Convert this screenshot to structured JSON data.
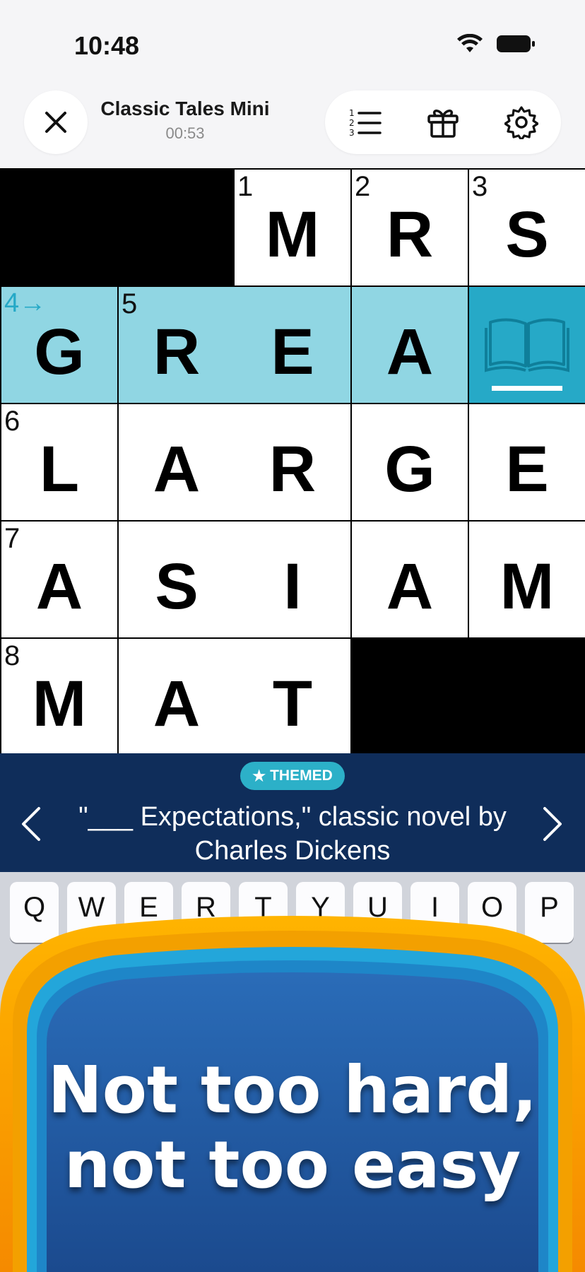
{
  "status_bar": {
    "time": "10:48",
    "wifi_icon": "wifi-icon",
    "battery_icon": "battery-icon"
  },
  "header": {
    "title": "Classic Tales Mini",
    "timer": "00:53",
    "close_icon": "close-icon",
    "tools": [
      "clue-list-icon",
      "gift-icon",
      "gear-icon"
    ]
  },
  "grid": {
    "rows": [
      [
        {
          "type": "black"
        },
        {
          "type": "black"
        },
        {
          "num": "1",
          "letter": "M"
        },
        {
          "num": "2",
          "letter": "R"
        },
        {
          "num": "3",
          "letter": "S"
        }
      ],
      [
        {
          "num": "4",
          "letter": "G",
          "state": "highlight",
          "dir": "→"
        },
        {
          "num": "5",
          "letter": "R",
          "state": "highlight"
        },
        {
          "letter": "E",
          "state": "highlight"
        },
        {
          "letter": "A",
          "state": "highlight"
        },
        {
          "state": "active",
          "icon": "open-book-icon"
        }
      ],
      [
        {
          "num": "6",
          "letter": "L"
        },
        {
          "letter": "A"
        },
        {
          "letter": "R"
        },
        {
          "letter": "G"
        },
        {
          "letter": "E"
        }
      ],
      [
        {
          "num": "7",
          "letter": "A"
        },
        {
          "letter": "S"
        },
        {
          "letter": "I"
        },
        {
          "letter": "A"
        },
        {
          "letter": "M"
        }
      ],
      [
        {
          "num": "8",
          "letter": "M"
        },
        {
          "letter": "A"
        },
        {
          "letter": "T"
        },
        {
          "type": "black"
        },
        {
          "type": "black"
        }
      ]
    ]
  },
  "clue": {
    "badge_star": "★",
    "badge": "THEMED",
    "line1": "\"___ Expectations,\" classic novel by",
    "line2": "Charles Dickens",
    "prev_icon": "chevron-left-icon",
    "next_icon": "chevron-right-icon"
  },
  "keyboard": {
    "row1": [
      "Q",
      "W",
      "E",
      "R",
      "T",
      "Y",
      "U",
      "I",
      "O",
      "P"
    ]
  },
  "promo": {
    "line1": "Not too hard,",
    "line2": "not too easy"
  },
  "colors": {
    "highlight": "#90d6e3",
    "active": "#26a9c7",
    "clue_bar": "#0f2d5a",
    "themed_badge": "#2cb0c8"
  }
}
